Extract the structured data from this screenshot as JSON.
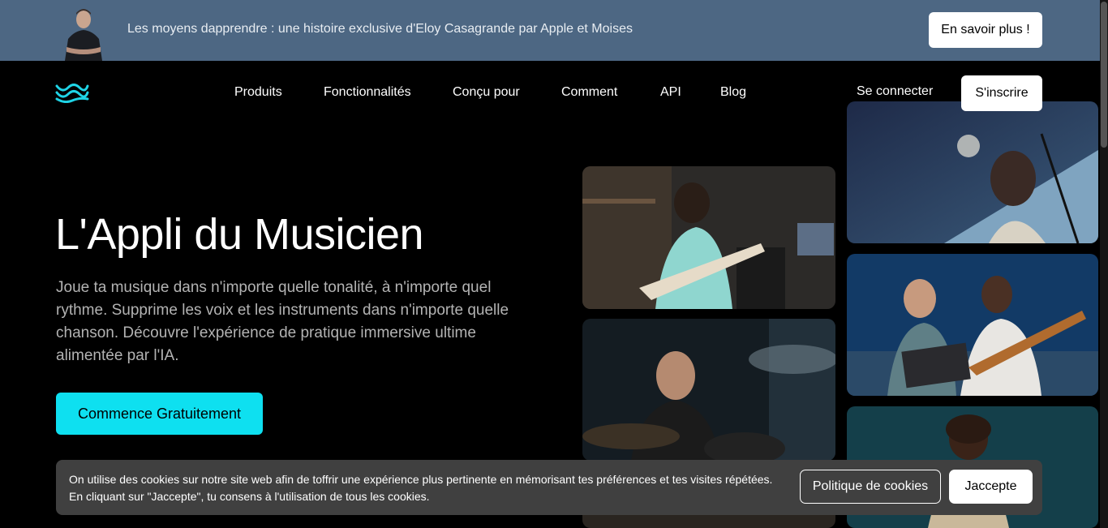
{
  "banner": {
    "text": "Les moyens dapprendre : une histoire exclusive d'Eloy Casagrande par Apple et Moises",
    "button_label": "En savoir plus !"
  },
  "nav": {
    "items": [
      {
        "label": "Produits"
      },
      {
        "label": "Fonctionnalités"
      },
      {
        "label": "Conçu pour"
      },
      {
        "label": "Comment"
      },
      {
        "label": "API"
      },
      {
        "label": "Blog"
      }
    ],
    "login_label": "Se connecter",
    "signup_label": "S'inscrire"
  },
  "hero": {
    "title": "L'Appli du Musicien",
    "description": "Joue ta musique dans n'importe quelle tonalité, à n'importe quel rythme. Supprime les voix et les instruments dans n'importe quelle chanson. Découvre l'expérience de pratique immersive ultime alimentée par l'IA.",
    "cta_label": "Commence Gratuitement"
  },
  "cookie": {
    "line1": "On utilise des cookies sur notre site web afin de toffrir une expérience plus pertinente en mémorisant tes préférences et tes visites répétées.",
    "line2": "En cliquant sur \"Jaccepte\", tu consens à l'utilisation de tous les cookies.",
    "policy_label": "Politique de cookies",
    "accept_label": "Jaccepte"
  },
  "colors": {
    "banner_bg": "#4d6783",
    "accent": "#0ee0f0",
    "logo": "#1fd4e6"
  },
  "icons": {
    "logo": "moises-wave-logo"
  }
}
